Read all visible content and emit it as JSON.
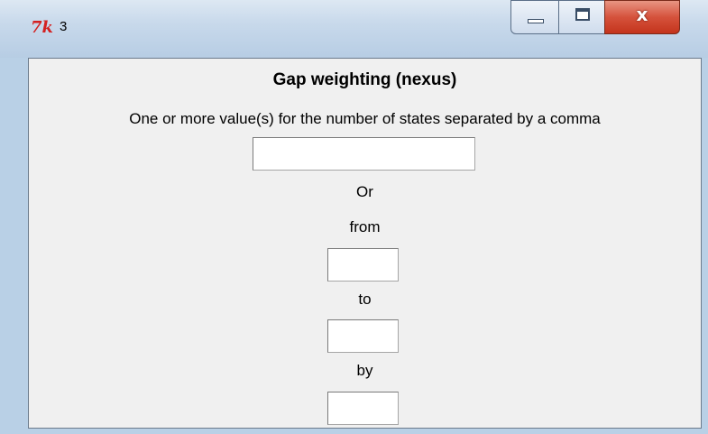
{
  "window": {
    "title": "3",
    "icon": "tk-feather-icon",
    "close_glyph": "x"
  },
  "form": {
    "heading": "Gap weighting (nexus)",
    "instruction": "One or more value(s) for the number of states separated by a comma",
    "values_input": "",
    "or_label": "Or",
    "from_label": "from",
    "from_input": "",
    "to_label": "to",
    "to_input": "",
    "by_label": "by",
    "by_input": ""
  }
}
